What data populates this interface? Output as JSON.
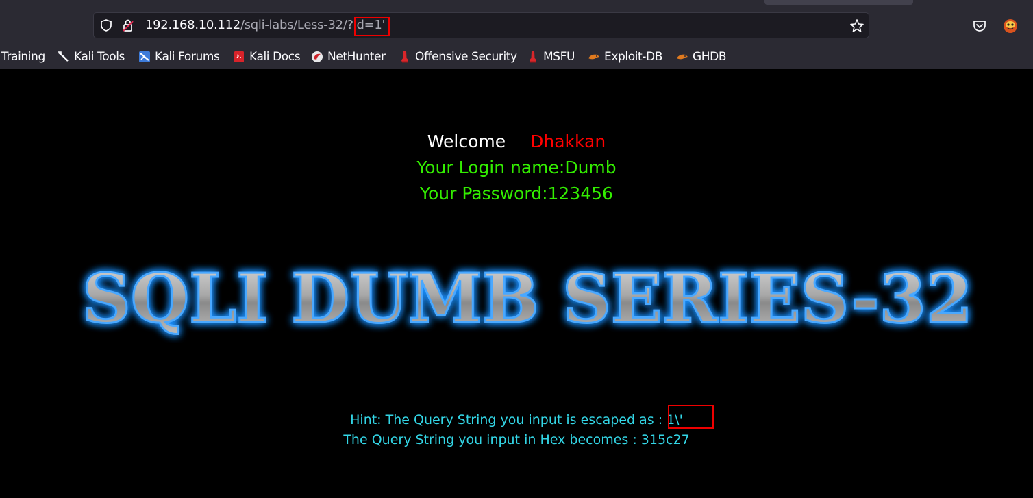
{
  "browser": {
    "url_host": "192.168.10.112",
    "url_path": "/sqli-labs/Less-32/?id=1'",
    "icons": [
      "shield-icon",
      "insecure-lock-icon",
      "star-icon",
      "pocket-icon",
      "extension-icon"
    ]
  },
  "bookmarks": [
    {
      "label": "Training",
      "icon": ""
    },
    {
      "label": "Kali Tools",
      "icon": "kali-tools-icon"
    },
    {
      "label": "Kali Forums",
      "icon": "kali-forums-icon"
    },
    {
      "label": "Kali Docs",
      "icon": "kali-docs-icon"
    },
    {
      "label": "NetHunter",
      "icon": "nethunter-icon"
    },
    {
      "label": "Offensive Security",
      "icon": "offsec-icon"
    },
    {
      "label": "MSFU",
      "icon": "msfu-icon"
    },
    {
      "label": "Exploit-DB",
      "icon": "exploitdb-icon"
    },
    {
      "label": "GHDB",
      "icon": "ghdb-icon"
    }
  ],
  "page": {
    "welcome": "Welcome",
    "welcome_name": "Dhakkan",
    "login_line": "Your Login name:Dumb",
    "password_line": "Your Password:123456",
    "banner": "SQLI DUMB SERIES-32",
    "hint_line": "Hint: The Query String you input is escaped as : 1\\'",
    "hex_line": "The Query String you input in Hex becomes : 315c27"
  },
  "colors": {
    "welcome": "#ffffff",
    "name": "#ff0000",
    "login": "#33ee00",
    "hint": "#33d6e6",
    "banner_glow": "#1e90ff",
    "highlight_box": "#ee0000"
  }
}
